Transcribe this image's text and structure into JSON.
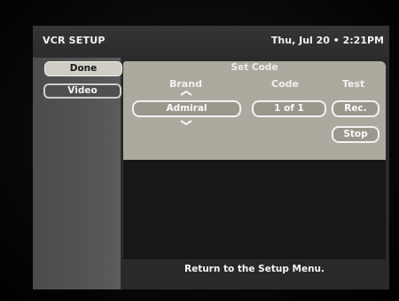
{
  "header": {
    "title": "VCR SETUP",
    "datetime": "Thu, Jul 20 • 2:21PM"
  },
  "sidebar": {
    "items": [
      {
        "label": "Done",
        "selected": true
      },
      {
        "label": "Video",
        "selected": false
      }
    ]
  },
  "dialog": {
    "title": "Set Code",
    "columns": {
      "brand": "Brand",
      "code": "Code",
      "test": "Test"
    },
    "brand_value": "Admiral",
    "code_value": "1 of 1",
    "rec_label": "Rec.",
    "stop_label": "Stop"
  },
  "help_text": "Return to the Setup Menu.",
  "colors": {
    "background": "#2a2a2a",
    "dialog": "#acaa9f",
    "selected_button": "#cfcdc4",
    "text": "#f4f4f4"
  },
  "icons": [
    "chevron-up-icon",
    "chevron-down-icon"
  ]
}
